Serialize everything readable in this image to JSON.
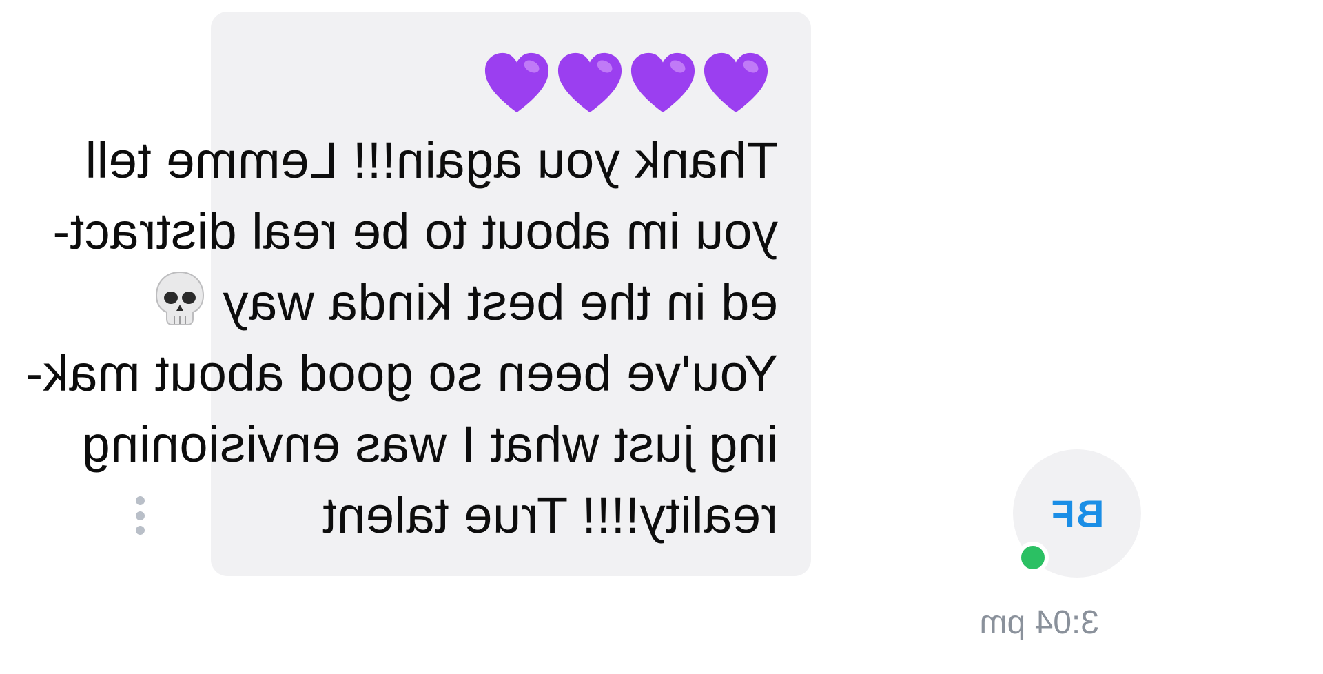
{
  "message": {
    "emoji_line": [
      "purple-heart",
      "purple-heart",
      "purple-heart",
      "purple-heart"
    ],
    "lines": [
      "Thank you again!!! Lemme tell",
      "you im about to be real distract-",
      "ed in the best kinda way",
      "You've been so good about mak-",
      "ing just what I was envisioning",
      "reality!!!! True talent"
    ],
    "inline_emoji": "skull",
    "timestamp": "3:04 pm"
  },
  "sender": {
    "initials": "BF",
    "status": "online"
  },
  "colors": {
    "bubble": "#f1f1f3",
    "text": "#0d0d0d",
    "initials": "#1b8ee6",
    "online": "#2bc063",
    "heart": "#9b3ff0",
    "timestamp": "#8a919b"
  }
}
